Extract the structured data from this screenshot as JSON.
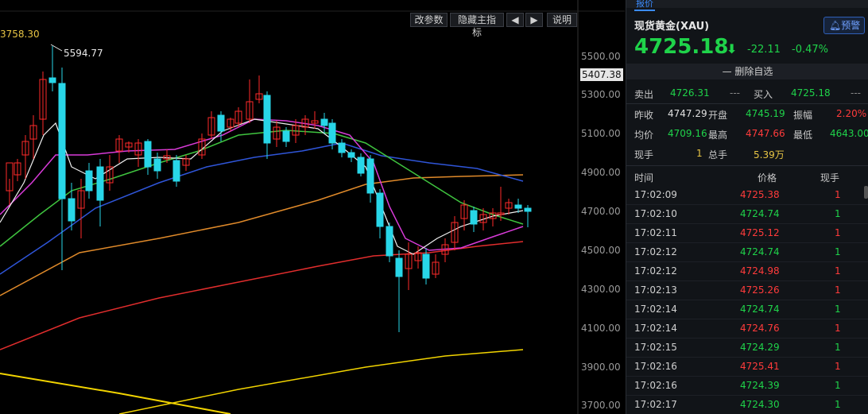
{
  "toolbar": {
    "params": "改参数",
    "hide_main": "隐藏主指标",
    "prev": "◀",
    "next": "▶",
    "help": "说明"
  },
  "chart": {
    "high_mark_left": "3758.30",
    "high_mark": "5594.77",
    "current_price_tag": "5407.38",
    "y_ticks": [
      "5500.00",
      "5300.00",
      "5100.00",
      "4900.00",
      "4700.00",
      "4500.00",
      "4300.00",
      "4100.00",
      "3900.00",
      "3700.00"
    ]
  },
  "quote": {
    "tab": "报价",
    "title": "现货黄金(XAU)",
    "alert_label": "预警",
    "price": "4725.18",
    "change": "-22.11",
    "change_pct": "-0.47%",
    "remove_watch": "— 删除自选",
    "sell_label": "卖出",
    "sell_value": "4726.31",
    "sell_dash": "---",
    "buy_label": "买入",
    "buy_value": "4725.18",
    "buy_dash": "---",
    "prev_close_label": "昨收",
    "prev_close": "4747.29",
    "open_label": "开盘",
    "open": "4745.19",
    "amplitude_label": "振幅",
    "amplitude": "2.20%",
    "avg_label": "均价",
    "avg": "4709.16",
    "high_label": "最高",
    "high": "4747.66",
    "low_label": "最低",
    "low": "4643.00",
    "cur_vol_label": "现手",
    "cur_vol": "1",
    "total_vol_label": "总手",
    "total_vol": "5.39万"
  },
  "ticks": {
    "headers": [
      "时间",
      "价格",
      "现手"
    ],
    "rows": [
      {
        "time": "17:02:09",
        "price": "4725.38",
        "vol": "1",
        "dir": "up"
      },
      {
        "time": "17:02:10",
        "price": "4724.74",
        "vol": "1",
        "dir": "down"
      },
      {
        "time": "17:02:11",
        "price": "4725.12",
        "vol": "1",
        "dir": "up"
      },
      {
        "time": "17:02:12",
        "price": "4724.74",
        "vol": "1",
        "dir": "down"
      },
      {
        "time": "17:02:12",
        "price": "4724.98",
        "vol": "1",
        "dir": "up"
      },
      {
        "time": "17:02:13",
        "price": "4725.26",
        "vol": "1",
        "dir": "up"
      },
      {
        "time": "17:02:14",
        "price": "4724.74",
        "vol": "1",
        "dir": "down"
      },
      {
        "time": "17:02:14",
        "price": "4724.76",
        "vol": "1",
        "dir": "up"
      },
      {
        "time": "17:02:15",
        "price": "4724.29",
        "vol": "1",
        "dir": "down"
      },
      {
        "time": "17:02:16",
        "price": "4725.41",
        "vol": "1",
        "dir": "up"
      },
      {
        "time": "17:02:16",
        "price": "4724.39",
        "vol": "1",
        "dir": "down"
      },
      {
        "time": "17:02:17",
        "price": "4724.30",
        "vol": "1",
        "dir": "down"
      }
    ]
  },
  "colors": {
    "up": "#ff3b3b",
    "down": "#1fd34a",
    "candle_up": "#ff2a2a",
    "candle_down": "#28d6e8"
  }
}
